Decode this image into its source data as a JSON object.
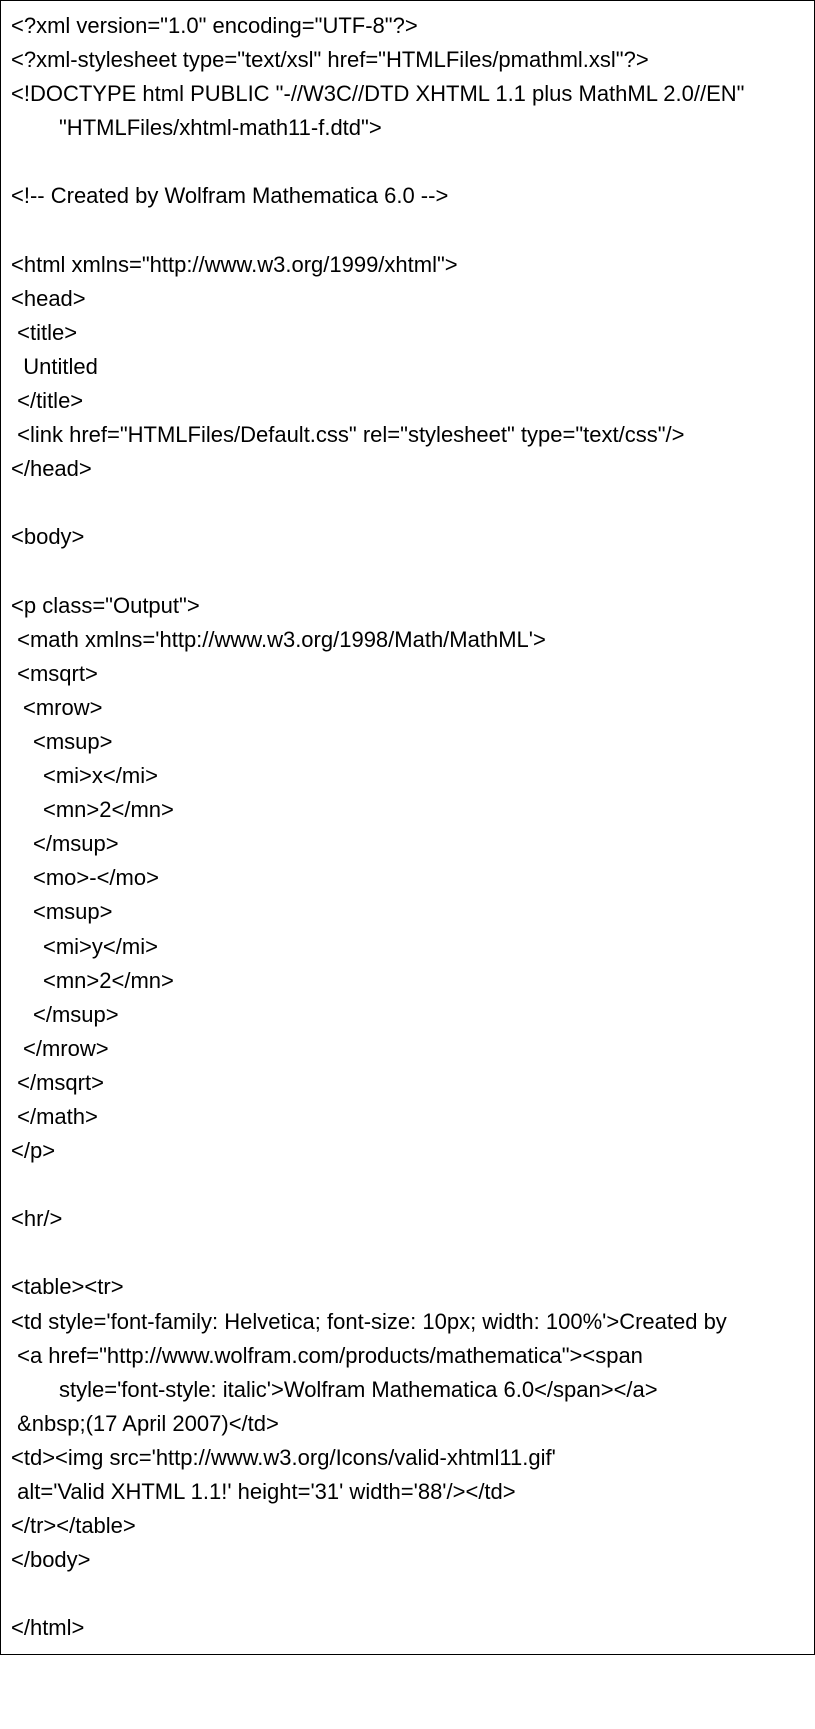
{
  "lines": [
    {
      "cls": "",
      "text": "<?xml version=\"1.0\" encoding=\"UTF-8\"?>"
    },
    {
      "cls": "",
      "text": "<?xml-stylesheet type=\"text/xsl\" href=\"HTMLFiles/pmathml.xsl\"?>"
    },
    {
      "cls": "",
      "text": "<!DOCTYPE html PUBLIC \"-//W3C//DTD XHTML 1.1 plus MathML 2.0//EN\""
    },
    {
      "cls": "indent1",
      "text": "\"HTMLFiles/xhtml-math11-f.dtd\">"
    },
    {
      "cls": "",
      "text": ""
    },
    {
      "cls": "",
      "text": "<!-- Created by Wolfram Mathematica 6.0 -->"
    },
    {
      "cls": "",
      "text": ""
    },
    {
      "cls": "",
      "text": "<html xmlns=\"http://www.w3.org/1999/xhtml\">"
    },
    {
      "cls": "",
      "text": "<head>"
    },
    {
      "cls": "",
      "text": " <title>"
    },
    {
      "cls": "",
      "text": "  Untitled"
    },
    {
      "cls": "",
      "text": " </title>"
    },
    {
      "cls": "",
      "text": " <link href=\"HTMLFiles/Default.css\" rel=\"stylesheet\" type=\"text/css\"/>"
    },
    {
      "cls": "",
      "text": "</head>"
    },
    {
      "cls": "",
      "text": ""
    },
    {
      "cls": "",
      "text": "<body>"
    },
    {
      "cls": "",
      "text": ""
    },
    {
      "cls": "",
      "text": "<p class=\"Output\">"
    },
    {
      "cls": "",
      "text": " <math xmlns='http://www.w3.org/1998/Math/MathML'>"
    },
    {
      "cls": "",
      "text": " <msqrt>"
    },
    {
      "cls": "indent-s",
      "text": "<mrow>"
    },
    {
      "cls": "indent-s2",
      "text": "<msup>"
    },
    {
      "cls": "indent-s3",
      "text": "<mi>x</mi>"
    },
    {
      "cls": "indent-s3",
      "text": "<mn>2</mn>"
    },
    {
      "cls": "indent-s2",
      "text": "</msup>"
    },
    {
      "cls": "indent-s2",
      "text": "<mo>-</mo>"
    },
    {
      "cls": "indent-s2",
      "text": "<msup>"
    },
    {
      "cls": "indent-s3",
      "text": "<mi>y</mi>"
    },
    {
      "cls": "indent-s3",
      "text": "<mn>2</mn>"
    },
    {
      "cls": "indent-s2",
      "text": "</msup>"
    },
    {
      "cls": "indent-s",
      "text": "</mrow>"
    },
    {
      "cls": "",
      "text": " </msqrt>"
    },
    {
      "cls": "",
      "text": " </math>"
    },
    {
      "cls": "",
      "text": "</p>"
    },
    {
      "cls": "",
      "text": ""
    },
    {
      "cls": "",
      "text": "<hr/>"
    },
    {
      "cls": "",
      "text": ""
    },
    {
      "cls": "",
      "text": "<table><tr>"
    },
    {
      "cls": "",
      "text": "<td style='font-family: Helvetica; font-size: 10px; width: 100%'>Created by "
    },
    {
      "cls": "",
      "text": " <a href=\"http://www.wolfram.com/products/mathematica\"><span"
    },
    {
      "cls": "indent1",
      "text": "style='font-style: italic'>Wolfram Mathematica 6.0</span></a>"
    },
    {
      "cls": "",
      "text": " &nbsp;(17 April 2007)</td>"
    },
    {
      "cls": "",
      "text": "<td><img src='http://www.w3.org/Icons/valid-xhtml11.gif'"
    },
    {
      "cls": "",
      "text": " alt='Valid XHTML 1.1!' height='31' width='88'/></td>"
    },
    {
      "cls": "",
      "text": "</tr></table>"
    },
    {
      "cls": "",
      "text": "</body>"
    },
    {
      "cls": "",
      "text": ""
    },
    {
      "cls": "",
      "text": "</html>"
    }
  ]
}
